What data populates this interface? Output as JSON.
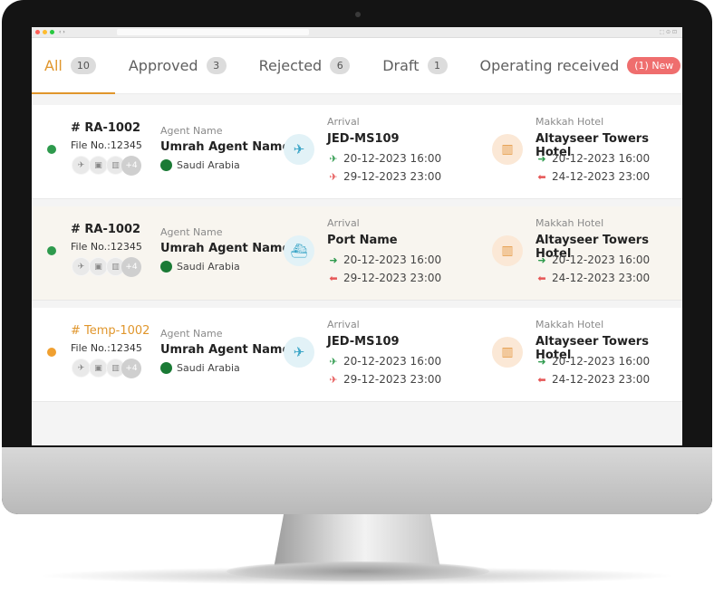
{
  "tabs": [
    {
      "label": "All",
      "count": "10"
    },
    {
      "label": "Approved",
      "count": "3"
    },
    {
      "label": "Rejected",
      "count": "6"
    },
    {
      "label": "Draft",
      "count": "1"
    },
    {
      "label": "Operating received",
      "count": "(1) New"
    }
  ],
  "colors": {
    "accent": "#e0962c",
    "approved_dot": "#2e9a4d",
    "temp_dot": "#f0a030",
    "new_badge": "#ef6e6e"
  },
  "rows": [
    {
      "ref": "# RA-1002",
      "file_no": "File No.:12345",
      "more_docs": "+4",
      "agent_label": "Agent Name",
      "agent_name": "Umrah Agent Name",
      "country": "Saudi Arabia",
      "transport_icon": "plane-crossed-icon",
      "arrival_label": "Arrival",
      "arrival_code": "JED-MS109",
      "arrival_in": "20-12-2023  16:00",
      "arrival_out": "29-12-2023  23:00",
      "hotel_label": "Makkah Hotel",
      "hotel_name": "Altayseer Towers Hotel",
      "hotel_in": "20-12-2023  16:00",
      "hotel_out": "24-12-2023  23:00"
    },
    {
      "ref": "# RA-1002",
      "file_no": "File No.:12345",
      "more_docs": "+4",
      "agent_label": "Agent Name",
      "agent_name": "Umrah Agent Name",
      "country": "Saudi Arabia",
      "transport_icon": "ship-icon",
      "arrival_label": "Arrival",
      "arrival_code": "Port  Name",
      "arrival_in": "20-12-2023  16:00",
      "arrival_out": "29-12-2023  23:00",
      "hotel_label": "Makkah Hotel",
      "hotel_name": "Altayseer Towers Hotel",
      "hotel_in": "20-12-2023  16:00",
      "hotel_out": "24-12-2023  23:00"
    },
    {
      "ref": "# Temp-1002",
      "file_no": "File No.:12345",
      "more_docs": "+4",
      "agent_label": "Agent Name",
      "agent_name": "Umrah Agent Name",
      "country": "Saudi Arabia",
      "transport_icon": "plane-crossed-icon",
      "arrival_label": "Arrival",
      "arrival_code": "JED-MS109",
      "arrival_in": "20-12-2023  16:00",
      "arrival_out": "29-12-2023  23:00",
      "hotel_label": "Makkah Hotel",
      "hotel_name": "Altayseer Towers Hotel",
      "hotel_in": "20-12-2023  16:00",
      "hotel_out": "24-12-2023  23:00"
    }
  ]
}
